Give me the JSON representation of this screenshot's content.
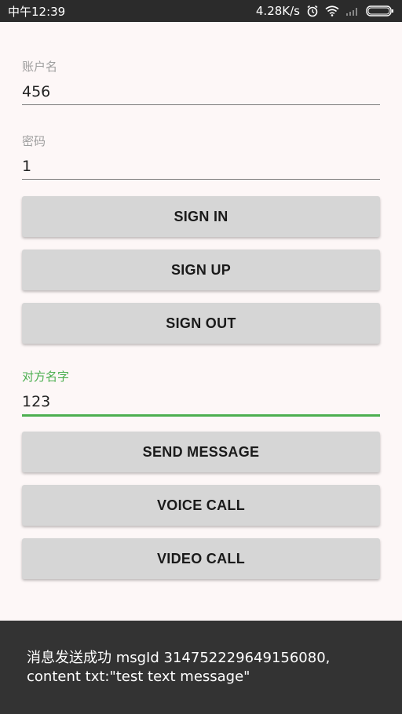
{
  "status_bar": {
    "time": "中午12:39",
    "network_speed": "4.28K/s",
    "icons": [
      "alarm-icon",
      "wifi-icon",
      "signal-icon",
      "battery-icon"
    ]
  },
  "form": {
    "account_label": "账户名",
    "account_value": "456",
    "password_label": "密码",
    "password_value": "1",
    "peer_label": "对方名字",
    "peer_value": "123"
  },
  "buttons": {
    "sign_in": "SIGN IN",
    "sign_up": "SIGN UP",
    "sign_out": "SIGN OUT",
    "send_message": "SEND MESSAGE",
    "voice_call": "VOICE CALL",
    "video_call": "VIDEO CALL"
  },
  "toast": {
    "message": "消息发送成功 msgId 314752229649156080, content txt:\"test text message\""
  },
  "colors": {
    "accent": "#4caf50",
    "background": "#fdf7f7",
    "button": "#d6d6d6",
    "status_bar": "#2b2b2b",
    "toast": "#333333"
  }
}
